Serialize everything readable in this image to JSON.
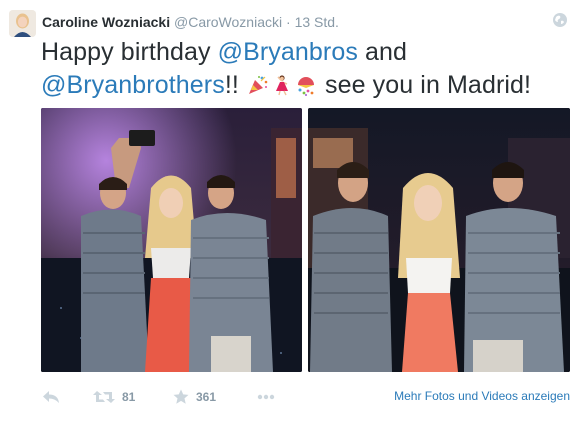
{
  "tweet": {
    "display_name": "Caroline Wozniacki",
    "handle": "@CaroWozniacki",
    "separator": "·",
    "time": "13 Std.",
    "text": {
      "part1": "Happy birthday ",
      "mention1": "@Bryanbros",
      "part2": " and",
      "mention2": "@Bryanbrothers",
      "part3": "!! ",
      "part4": " see you in Madrid!"
    },
    "emojis": [
      "party-popper",
      "dancer",
      "confetti-ball"
    ]
  },
  "actions": {
    "retweet_count": "81",
    "favorite_count": "361",
    "more_media_label": "Mehr Fotos und Videos anzeigen"
  },
  "colors": {
    "link": "#2b7bb9",
    "text": "#292f33",
    "muted": "#8899a6"
  },
  "icons": [
    "globe-icon",
    "reply-icon",
    "retweet-icon",
    "star-icon",
    "more-icon"
  ]
}
